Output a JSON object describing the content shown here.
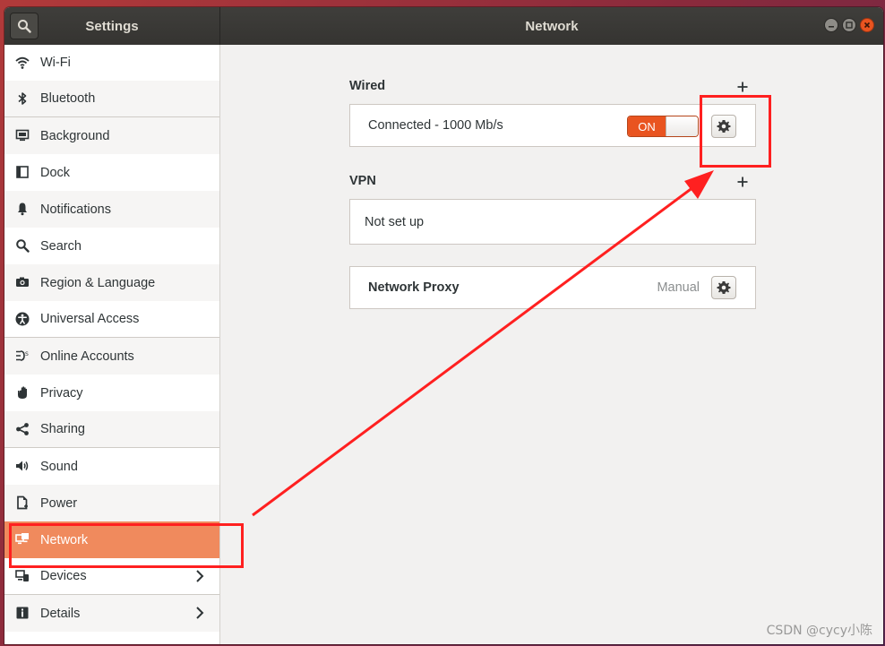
{
  "window": {
    "sidebar_title": "Settings",
    "title": "Network"
  },
  "sidebar": {
    "items": [
      {
        "label": "Wi-Fi",
        "icon": "wifi-icon"
      },
      {
        "label": "Bluetooth",
        "icon": "bluetooth-icon"
      },
      {
        "label": "Background",
        "icon": "background-icon"
      },
      {
        "label": "Dock",
        "icon": "dock-icon"
      },
      {
        "label": "Notifications",
        "icon": "bell-icon"
      },
      {
        "label": "Search",
        "icon": "search-icon"
      },
      {
        "label": "Region & Language",
        "icon": "camera-icon"
      },
      {
        "label": "Universal Access",
        "icon": "universal-access-icon"
      },
      {
        "label": "Online Accounts",
        "icon": "online-accounts-icon"
      },
      {
        "label": "Privacy",
        "icon": "hand-icon"
      },
      {
        "label": "Sharing",
        "icon": "share-icon"
      },
      {
        "label": "Sound",
        "icon": "speaker-icon"
      },
      {
        "label": "Power",
        "icon": "power-icon"
      },
      {
        "label": "Network",
        "icon": "network-icon",
        "selected": true
      },
      {
        "label": "Devices",
        "icon": "devices-icon",
        "chevron": true
      },
      {
        "label": "Details",
        "icon": "info-icon",
        "chevron": true
      }
    ]
  },
  "network": {
    "wired": {
      "heading": "Wired",
      "status": "Connected - 1000 Mb/s",
      "switch_label": "ON",
      "switch_on": true
    },
    "vpn": {
      "heading": "VPN",
      "empty_text": "Not set up"
    },
    "proxy": {
      "label": "Network Proxy",
      "value": "Manual"
    }
  },
  "colors": {
    "accent": "#e95420",
    "selected_row": "#f08a5d",
    "annotation": "#ff2020"
  },
  "watermark": "CSDN @cycy小陈"
}
